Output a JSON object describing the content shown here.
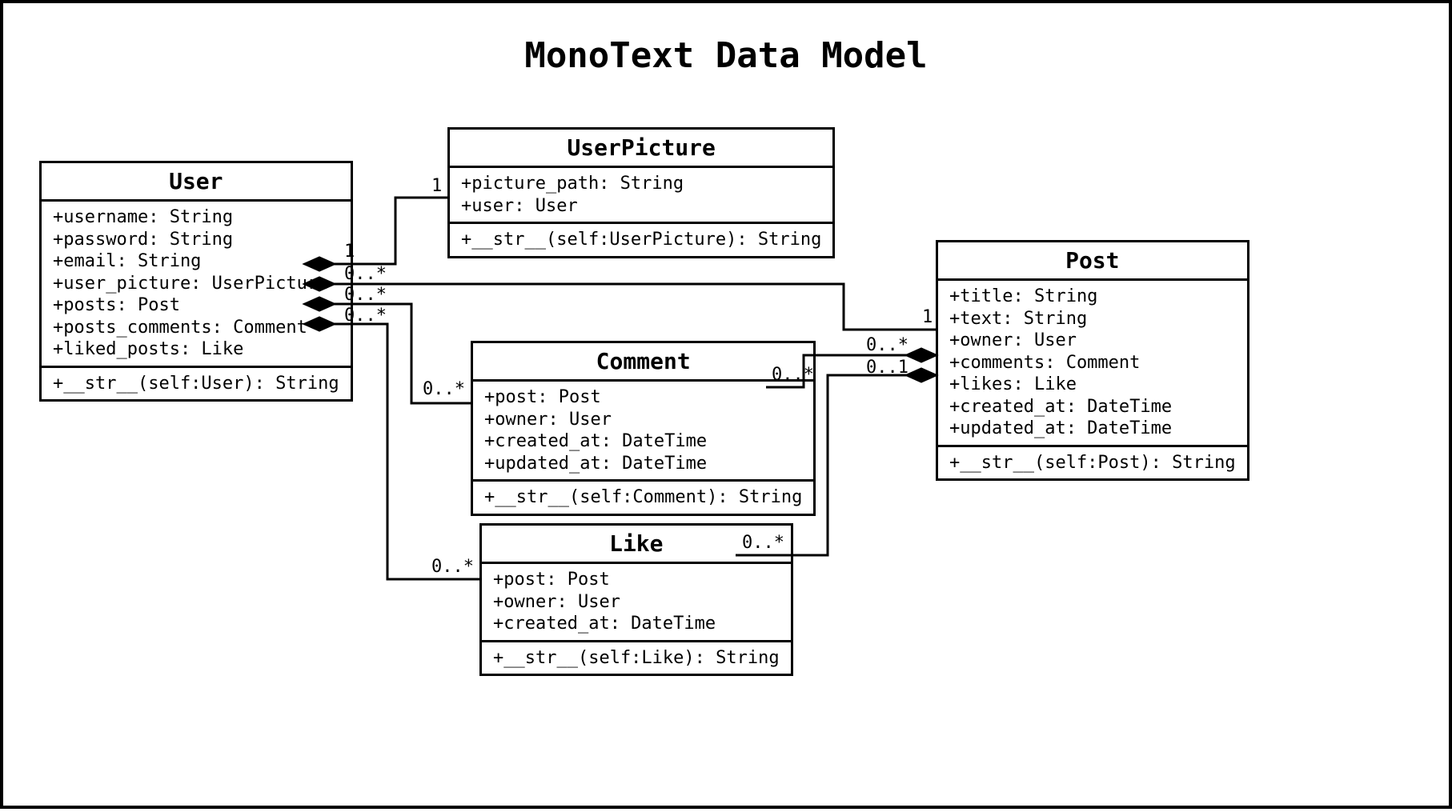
{
  "title": "MonoText Data Model",
  "classes": {
    "user": {
      "name": "User",
      "attrs": [
        "+username: String",
        "+password: String",
        "+email: String",
        "+user_picture: UserPicture",
        "+posts: Post",
        "+posts_comments: Comment",
        "+liked_posts: Like"
      ],
      "ops": [
        "+__str__(self:User): String"
      ]
    },
    "userpicture": {
      "name": "UserPicture",
      "attrs": [
        "+picture_path: String",
        "+user: User"
      ],
      "ops": [
        "+__str__(self:UserPicture): String"
      ]
    },
    "post": {
      "name": "Post",
      "attrs": [
        "+title: String",
        "+text: String",
        "+owner: User",
        "+comments: Comment",
        "+likes: Like",
        "+created_at: DateTime",
        "+updated_at: DateTime"
      ],
      "ops": [
        "+__str__(self:Post): String"
      ]
    },
    "comment": {
      "name": "Comment",
      "attrs": [
        "+post: Post",
        "+owner: User",
        "+created_at: DateTime",
        "+updated_at: DateTime"
      ],
      "ops": [
        "+__str__(self:Comment): String"
      ]
    },
    "like": {
      "name": "Like",
      "attrs": [
        "+post: Post",
        "+owner: User",
        "+created_at: DateTime"
      ],
      "ops": [
        "+__str__(self:Like): String"
      ]
    }
  },
  "multiplicities": {
    "user_to_pic_user": "1",
    "user_to_pic_pic": "1",
    "user_posts": "0..*",
    "user_comments": "0..*",
    "user_likes": "0..*",
    "comment_user_side": "0..*",
    "like_user_side": "0..*",
    "post_owner_user_side": "1",
    "post_comments_post_side": "0..*",
    "post_likes_post_side": "0..1",
    "comment_post_side": "0..*",
    "like_post_side": "0..*"
  }
}
